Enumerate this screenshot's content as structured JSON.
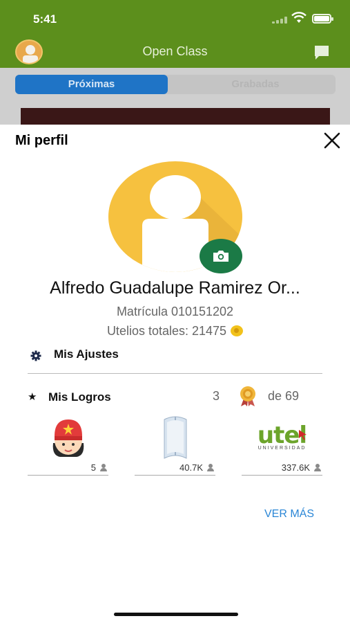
{
  "status_bar": {
    "time": "5:41"
  },
  "app_bar": {
    "title": "Open Class"
  },
  "tabs": {
    "active": "Próximas",
    "inactive": "Grabadas"
  },
  "profile_sheet": {
    "title": "Mi perfil",
    "name": "Alfredo Guadalupe Ramirez Or...",
    "matricula": "Matrícula 010151202",
    "utelios": "Utelios totales: 21475",
    "settings_label": "Mis Ajustes",
    "achievements": {
      "label": "Mis Logros",
      "count": "3",
      "total": "de 69",
      "badges": [
        {
          "name": "hero-badge",
          "value": "5"
        },
        {
          "name": "book-badge",
          "value": "40.7K"
        },
        {
          "name": "utel-badge",
          "value": "337.6K",
          "logo_text": "utel",
          "logo_sub": "UNIVERSIDAD"
        }
      ]
    },
    "more_link": "VER MÁS"
  },
  "colors": {
    "brand_green": "#5c8f1c",
    "accent_blue": "#1f74c6",
    "camera_green": "#1b7a46",
    "avatar_yellow": "#f6c13f"
  }
}
